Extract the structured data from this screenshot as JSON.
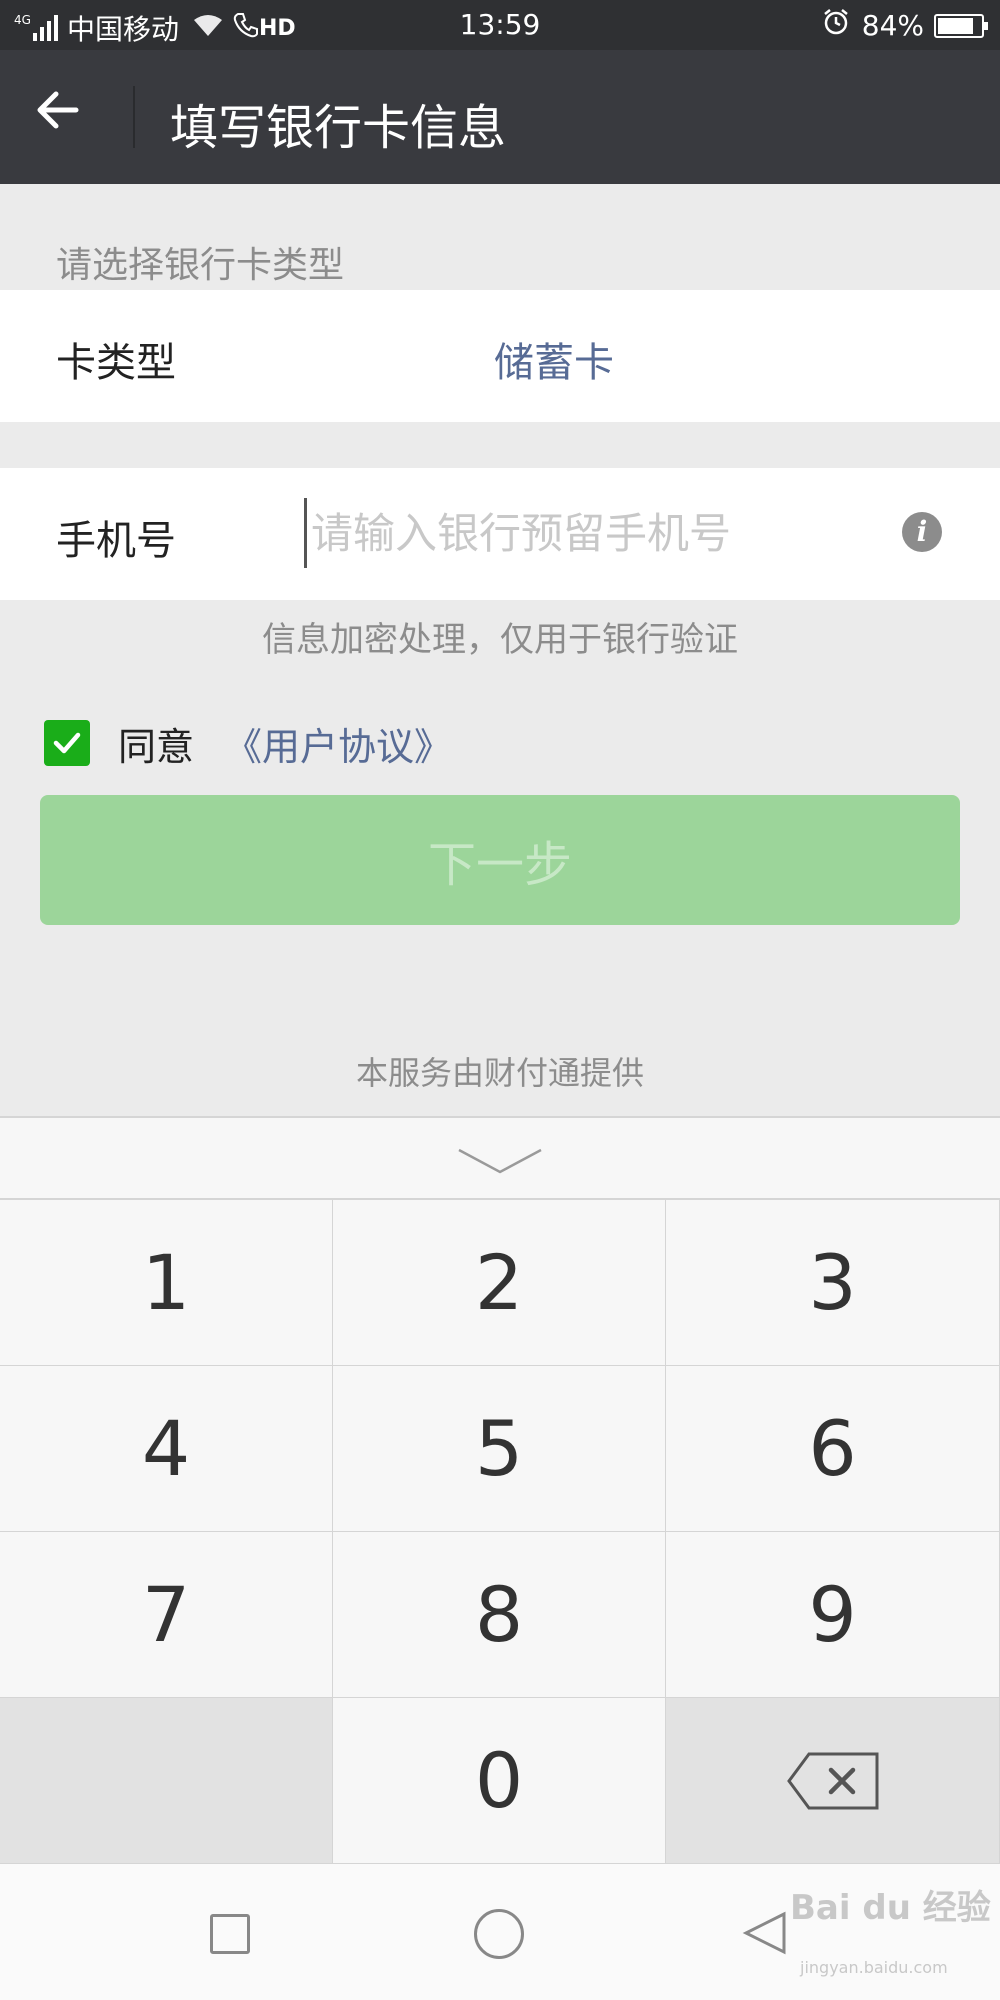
{
  "status_bar": {
    "network_type": "4G",
    "carrier": "中国移动",
    "call_badge": "HD",
    "time": "13:59",
    "battery_percent": "84%",
    "battery_level": 0.84
  },
  "header": {
    "title": "填写银行卡信息"
  },
  "card_type_section": {
    "label": "请选择银行卡类型",
    "row_label": "卡类型",
    "value": "储蓄卡"
  },
  "phone_section": {
    "row_label": "手机号",
    "value": "",
    "placeholder": "请输入银行预留手机号",
    "note": "信息加密处理，仅用于银行验证"
  },
  "agreement": {
    "checked": true,
    "label": "同意",
    "link_text": "《用户协议》"
  },
  "next_button": {
    "label": "下一步"
  },
  "provider_note": "本服务由财付通提供",
  "keyboard": {
    "keys": [
      "1",
      "2",
      "3",
      "4",
      "5",
      "6",
      "7",
      "8",
      "9",
      "",
      "0",
      "backspace-icon"
    ]
  },
  "watermark": {
    "brand": "Bai du 经验",
    "url": "jingyan.baidu.com"
  },
  "colors": {
    "header_bg": "#393a3f",
    "link_blue": "#576b95",
    "brand_green": "#1aad19",
    "button_disabled_green": "#9cd59a"
  }
}
